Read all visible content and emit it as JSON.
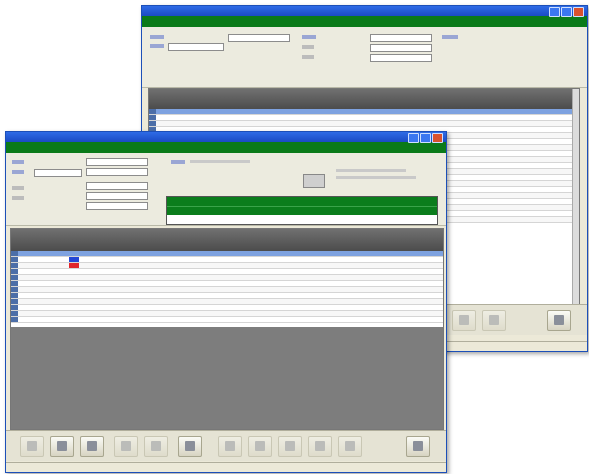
{
  "back_window": {
    "title": "",
    "header": "",
    "grid_rows": 19,
    "toolbar_buttons": 4,
    "status": ""
  },
  "front_window": {
    "title": "",
    "header": "",
    "grid_rows": 12,
    "toolbar_buttons": 14,
    "status": ""
  },
  "colors": {
    "title_blue": "#1a4bc4",
    "header_green": "#0a7a19",
    "grid_header": "#5a5a5a",
    "selection": "#7ea2e0",
    "marker_blue": "#2447d6",
    "marker_red": "#e0262d"
  }
}
